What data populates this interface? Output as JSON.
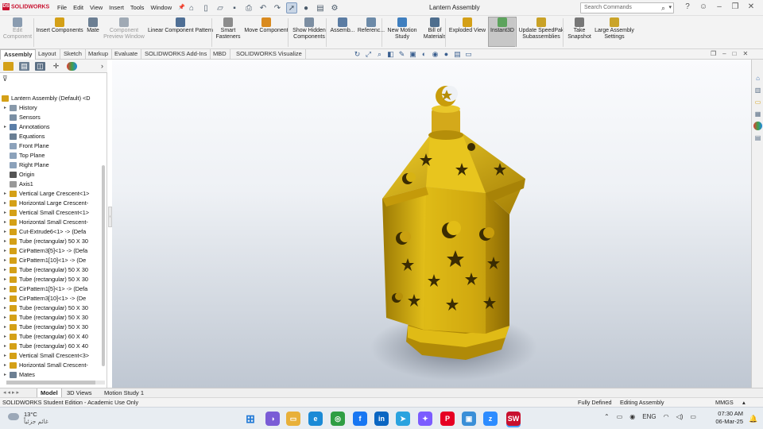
{
  "app": {
    "logo_text": "SOLIDWORKS",
    "title": "Lantern Assembly"
  },
  "menus": [
    "File",
    "Edit",
    "View",
    "Insert",
    "Tools",
    "Window"
  ],
  "search": {
    "placeholder": "Search Commands"
  },
  "ribbon": {
    "buttons": [
      {
        "label": "Edit\nComponent",
        "enabled": false,
        "color": "#8a9cb0"
      },
      {
        "label": "Insert Components",
        "enabled": true,
        "color": "#d4a017"
      },
      {
        "label": "Mate",
        "enabled": true,
        "color": "#6c7f93"
      },
      {
        "label": "Component\nPreview Window",
        "enabled": false,
        "color": "#a0aab5"
      },
      {
        "label": "Linear Component Pattern",
        "enabled": true,
        "color": "#4f6f95"
      },
      {
        "label": "Smart\nFasteners",
        "enabled": true,
        "color": "#8c8c8c"
      },
      {
        "label": "Move Component",
        "enabled": true,
        "color": "#d98a1f"
      },
      {
        "label": "Show Hidden\nComponents",
        "enabled": true,
        "color": "#7c8ea2"
      },
      {
        "label": "Assemb...",
        "enabled": true,
        "color": "#5b7ca3"
      },
      {
        "label": "Referenc...",
        "enabled": true,
        "color": "#6c8aa8"
      },
      {
        "label": "New Motion\nStudy",
        "enabled": true,
        "color": "#3f7fbf"
      },
      {
        "label": "Bill of\nMaterials",
        "enabled": true,
        "color": "#4e6e8e"
      },
      {
        "label": "Exploded View",
        "enabled": true,
        "color": "#d4a017"
      },
      {
        "label": "Instant3D",
        "enabled": true,
        "selected": true,
        "color": "#5da35d"
      },
      {
        "label": "Update SpeedPak\nSubassemblies",
        "enabled": true,
        "color": "#c9a227"
      },
      {
        "label": "Take\nSnapshot",
        "enabled": true,
        "color": "#777777"
      },
      {
        "label": "Large Assembly\nSettings",
        "enabled": true,
        "color": "#caa42a"
      }
    ]
  },
  "command_tabs": [
    {
      "label": "Assembly",
      "active": true
    },
    {
      "label": "Layout"
    },
    {
      "label": "Sketch"
    },
    {
      "label": "Markup"
    },
    {
      "label": "Evaluate"
    },
    {
      "label": "SOLIDWORKS Add-Ins"
    },
    {
      "label": "MBD"
    },
    {
      "label": "SOLIDWORKS Visualize"
    }
  ],
  "feature_tree": {
    "items": [
      {
        "label": "Lantern Assembly (Default) <D",
        "icon": "assembly-icon",
        "expand": "",
        "color": "#d4a017"
      },
      {
        "label": "History",
        "icon": "history-icon",
        "expand": "▸",
        "color": "#8899aa"
      },
      {
        "label": "Sensors",
        "icon": "sensors-icon",
        "expand": "",
        "color": "#7a8fa4"
      },
      {
        "label": "Annotations",
        "icon": "annotations-icon",
        "expand": "▸",
        "color": "#5a7ea8"
      },
      {
        "label": "Equations",
        "icon": "equations-icon",
        "expand": "",
        "color": "#6a7f94"
      },
      {
        "label": "Front Plane",
        "icon": "plane-icon",
        "expand": "",
        "color": "#8ca2bb"
      },
      {
        "label": "Top Plane",
        "icon": "plane-icon",
        "expand": "",
        "color": "#8ca2bb"
      },
      {
        "label": "Right Plane",
        "icon": "plane-icon",
        "expand": "",
        "color": "#8ca2bb"
      },
      {
        "label": "Origin",
        "icon": "origin-icon",
        "expand": "",
        "color": "#555555"
      },
      {
        "label": "Axis1",
        "icon": "axis-icon",
        "expand": "",
        "color": "#999999"
      },
      {
        "label": "Vertical Large Crescent<1>",
        "icon": "part-icon",
        "expand": "▸",
        "color": "#d4a017"
      },
      {
        "label": "Horizontal Large Crescent-",
        "icon": "part-icon",
        "expand": "▸",
        "color": "#d4a017"
      },
      {
        "label": "Vertical Small Crescent<1>",
        "icon": "part-icon",
        "expand": "▸",
        "color": "#d4a017"
      },
      {
        "label": "Horizontal Small Crescent-",
        "icon": "part-icon",
        "expand": "▸",
        "color": "#d4a017"
      },
      {
        "label": "Cut-Extrude6<1> -> (Defa",
        "icon": "part-icon",
        "expand": "▸",
        "color": "#d4a017"
      },
      {
        "label": "Tube (rectangular) 50 X 30",
        "icon": "part-icon",
        "expand": "▸",
        "color": "#d4a017"
      },
      {
        "label": "CirPattern3[5]<1> -> (Defa",
        "icon": "part-icon",
        "expand": "▸",
        "color": "#d4a017"
      },
      {
        "label": "CirPattern1[10]<1> -> (De",
        "icon": "part-icon",
        "expand": "▸",
        "color": "#d4a017"
      },
      {
        "label": "Tube (rectangular) 50 X 30",
        "icon": "part-icon",
        "expand": "▸",
        "color": "#d4a017"
      },
      {
        "label": "Tube (rectangular) 50 X 30",
        "icon": "part-icon",
        "expand": "▸",
        "color": "#d4a017"
      },
      {
        "label": "CirPattern1[5]<1> -> (Defa",
        "icon": "part-icon",
        "expand": "▸",
        "color": "#d4a017"
      },
      {
        "label": "CirPattern3[10]<1> -> (De",
        "icon": "part-icon",
        "expand": "▸",
        "color": "#d4a017"
      },
      {
        "label": "Tube (rectangular) 50 X 30",
        "icon": "part-icon",
        "expand": "▸",
        "color": "#d4a017"
      },
      {
        "label": "Tube (rectangular) 50 X 30",
        "icon": "part-icon",
        "expand": "▸",
        "color": "#d4a017"
      },
      {
        "label": "Tube (rectangular) 50 X 30",
        "icon": "part-icon",
        "expand": "▸",
        "color": "#d4a017"
      },
      {
        "label": "Tube (rectangular) 60 X 40",
        "icon": "part-icon",
        "expand": "▸",
        "color": "#d4a017"
      },
      {
        "label": "Tube (rectangular) 60 X 40",
        "icon": "part-icon",
        "expand": "▸",
        "color": "#d4a017"
      },
      {
        "label": "Vertical Small Crescent<3>",
        "icon": "part-icon",
        "expand": "▸",
        "color": "#d4a017"
      },
      {
        "label": "Horizontal Small Crescent-",
        "icon": "part-icon",
        "expand": "▸",
        "color": "#d4a017"
      },
      {
        "label": "Mates",
        "icon": "mates-icon",
        "expand": "▸",
        "color": "#6c7f93"
      }
    ]
  },
  "bottom_tabs": [
    {
      "label": "Model",
      "active": true
    },
    {
      "label": "3D Views"
    },
    {
      "label": "Motion Study 1"
    }
  ],
  "status": {
    "edition": "SOLIDWORKS Student Edition - Academic Use Only",
    "definition": "Fully Defined",
    "mode": "Editing Assembly",
    "units": "MMGS"
  },
  "taskbar": {
    "temperature": "13°C",
    "weather_text": "غائم جزئياً",
    "language": "ENG",
    "time": "07:30 AM",
    "date": "06-Mar-25",
    "apps": [
      {
        "name": "start-icon",
        "color": "#1e78d6",
        "glyph": "⊞"
      },
      {
        "name": "copilot-icon",
        "color": "#7a5cd6",
        "glyph": "◑"
      },
      {
        "name": "file-explorer-icon",
        "color": "#e8b03a",
        "glyph": "▭"
      },
      {
        "name": "edge-icon",
        "color": "#1b8ad6",
        "glyph": "e"
      },
      {
        "name": "chrome-icon",
        "color": "#2f9e44",
        "glyph": "◎"
      },
      {
        "name": "facebook-icon",
        "color": "#1877f2",
        "glyph": "f"
      },
      {
        "name": "linkedin-icon",
        "color": "#0a66c2",
        "glyph": "in"
      },
      {
        "name": "telegram-icon",
        "color": "#2aa3df",
        "glyph": "➤"
      },
      {
        "name": "messenger-icon",
        "color": "#7b5cff",
        "glyph": "✦"
      },
      {
        "name": "pinterest-icon",
        "color": "#e60023",
        "glyph": "P"
      },
      {
        "name": "photos-icon",
        "color": "#3a8fd8",
        "glyph": "▣"
      },
      {
        "name": "zoom-icon",
        "color": "#2d8cff",
        "glyph": "z"
      },
      {
        "name": "solidworks-taskbar-icon",
        "color": "#c8102e",
        "glyph": "SW"
      }
    ]
  },
  "colors": {
    "gold": "#d4a017",
    "accent": "#c8102e"
  }
}
